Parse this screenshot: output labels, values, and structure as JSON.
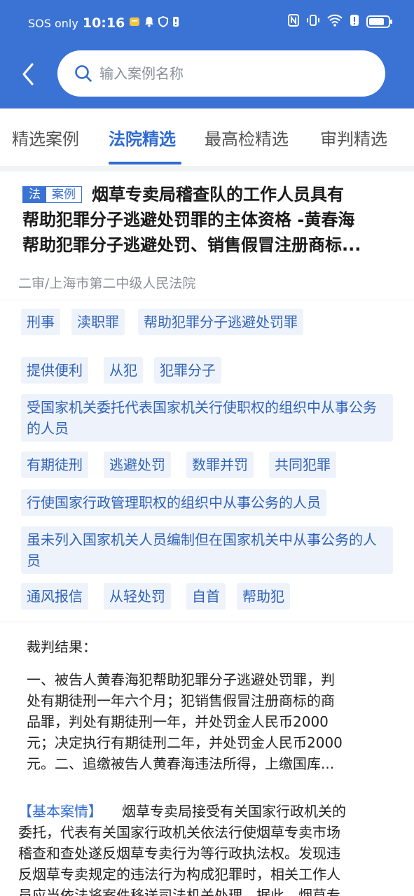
{
  "status_bar": {
    "carrier": "SOS only",
    "time": "10:16"
  },
  "search": {
    "placeholder": "输入案例名称"
  },
  "tabs": [
    {
      "label": "精选案例"
    },
    {
      "label": "法院精选"
    },
    {
      "label": "最高检精选"
    },
    {
      "label": "审判精选"
    }
  ],
  "case": {
    "badge_type": "法",
    "badge_label": "案例",
    "title_line1": "烟草专卖局稽查队的工作人员具有",
    "title_line2": "帮助犯罪分子逃避处罚罪的主体资格 -黄春海",
    "title_line3": "帮助犯罪分子逃避处罚、销售假冒注册商标...",
    "court": "二审/上海市第二中级人民法院"
  },
  "tags": [
    "刑事",
    "渎职罪",
    "帮助犯罪分子逃避处罚罪",
    "提供便利",
    "从犯",
    "犯罪分子",
    "受国家机关委托代表国家机关行使职权的组织中从事公务的人员",
    "有期徒刑",
    "逃避处罚",
    "数罪并罚",
    "共同犯罪",
    "行使国家行政管理职权的组织中从事公务的人员",
    "虽未列入国家机关人员编制但在国家机关中从事公务的人员",
    "通风报信",
    "从轻处罚",
    "自首",
    "帮助犯"
  ],
  "judgment": {
    "title": "裁判结果：",
    "line1": "一、被告人黄春海犯帮助犯罪分子逃避处罚罪，判",
    "line2": "处有期徒刑一年六个月；犯销售假冒注册商标的商",
    "line3": "品罪，判处有期徒刑一年，并处罚金人民币2000",
    "line4": "元；决定执行有期徒刑二年，并处罚金人民币2000",
    "line5": "元。二、追缴被告人黄春海违法所得，上缴国库..."
  },
  "basic_case": {
    "label": "【基本案情】",
    "line1": "烟草专卖局接受有关国家行政机关的",
    "line2": "委托，代表有关国家行政机关依法行使烟草专卖市场",
    "line3": "稽查和查处遂反烟草专卖行为等行政执法权。发现违",
    "line4": "反烟草专卖规定的违法行为构成犯罪时，相关工作人",
    "line5": "员应当依法将案件移送司法机关处理。据此，烟草专"
  },
  "colors": {
    "header": "#3a73d4",
    "accent": "#2f6bd1",
    "tag_bg": "#eef3fb",
    "tag_text": "#2f62b8"
  },
  "icons": [
    "back-arrow-icon",
    "search-icon",
    "battery-icon",
    "wifi-icon",
    "nfc-icon"
  ]
}
